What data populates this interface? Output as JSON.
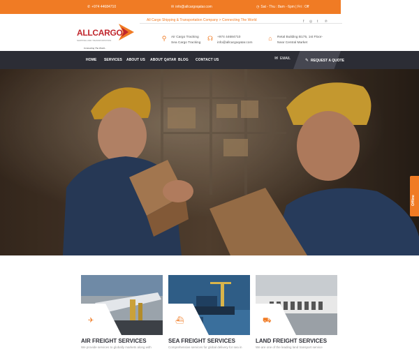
{
  "topbar": {
    "phone": "+974 44684710",
    "email": "info@allcargoqatar.com",
    "hours": "Sat - Thu : 8am - 6pm | Fri : Off"
  },
  "header": {
    "logo_name": "ALLCARGO",
    "logo_small": "SHIPPING AND TRANSPORTATION",
    "logo_tag": "Connecting The World...",
    "tagline": "All Cargo Shipping & Transportation Company > Connecting The World",
    "social": [
      "facebook",
      "instagram",
      "twitter",
      "pinterest"
    ],
    "info": [
      {
        "icon": "map-pin-icon",
        "line1": "Air Cargo Tracking",
        "line2": "Sea Cargo Tracking"
      },
      {
        "icon": "headset-icon",
        "line1": "+974 44684710",
        "line2": "info@allcargoqatar.com"
      },
      {
        "icon": "home-icon",
        "line1": "Retal Building B175, 1st Floor-",
        "line2": "Near Central Market"
      }
    ]
  },
  "nav": {
    "links": [
      "HOME",
      "SERVICES",
      "ABOUT US",
      "ABOUT QATAR",
      "BLOG",
      "CONTACT US"
    ],
    "email": "EMAIL",
    "quote": "REQUEST A QUOTE"
  },
  "offline": "Offline",
  "services": [
    {
      "title": "AIR FREIGHT SERVICES",
      "icon": "plane-icon",
      "desc": "We provide services to globally markets along with"
    },
    {
      "title": "SEA FREIGHT SERVICES",
      "icon": "ship-icon",
      "desc": "Comprehensive services for global delivery for sea in"
    },
    {
      "title": "LAND FREIGHT SERVICES",
      "icon": "truck-icon",
      "desc": "We are one of the leading land transport service"
    }
  ]
}
